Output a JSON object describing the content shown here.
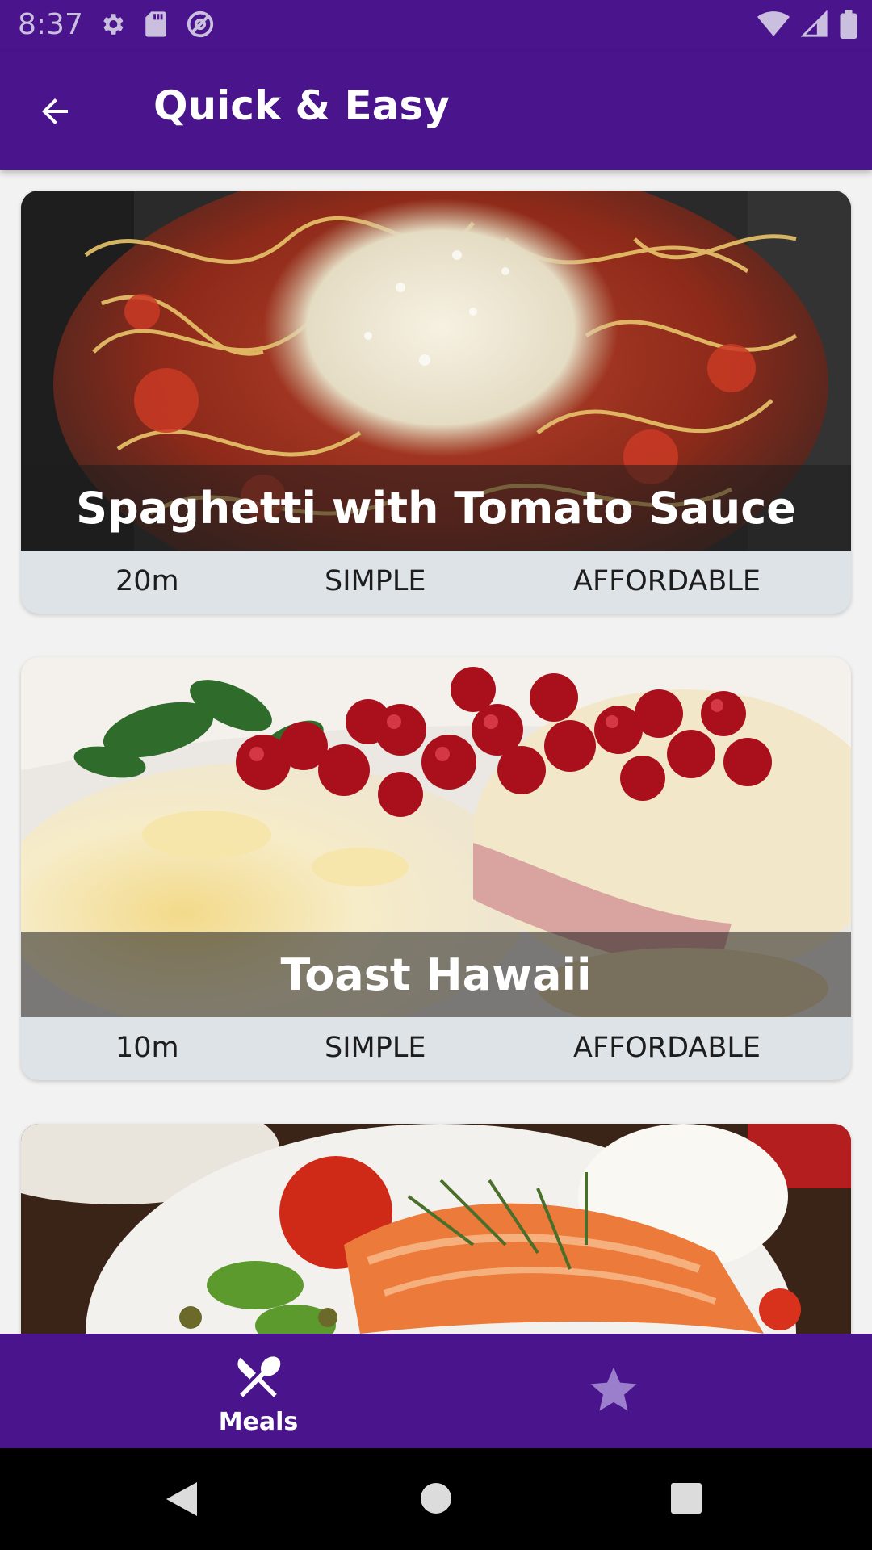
{
  "status_bar": {
    "time": "8:37",
    "left_icons": [
      "settings-icon",
      "sd-card-icon",
      "at-sign-icon"
    ],
    "right_icons": [
      "wifi-icon",
      "signal-icon",
      "battery-icon"
    ]
  },
  "app_bar": {
    "title": "Quick & Easy",
    "back_icon": "arrow-back-icon"
  },
  "meals": [
    {
      "title": "Spaghetti with Tomato Sauce",
      "duration": "20m",
      "complexity": "SIMPLE",
      "affordability": "AFFORDABLE"
    },
    {
      "title": "Toast Hawaii",
      "duration": "10m",
      "complexity": "SIMPLE",
      "affordability": "AFFORDABLE"
    },
    {
      "title": "",
      "duration": "",
      "complexity": "",
      "affordability": ""
    }
  ],
  "bottom_nav": {
    "items": [
      {
        "label": "Meals",
        "icon": "fork-knife-icon",
        "active": true
      },
      {
        "label": "",
        "icon": "star-icon",
        "active": false
      }
    ]
  },
  "colors": {
    "primary": "#4a148c",
    "card_meta_bg": "#dee3e8",
    "inactive_icon": "#9c7fcc"
  },
  "system_nav": {
    "icons": [
      "back-triangle-icon",
      "home-circle-icon",
      "recents-square-icon"
    ]
  }
}
